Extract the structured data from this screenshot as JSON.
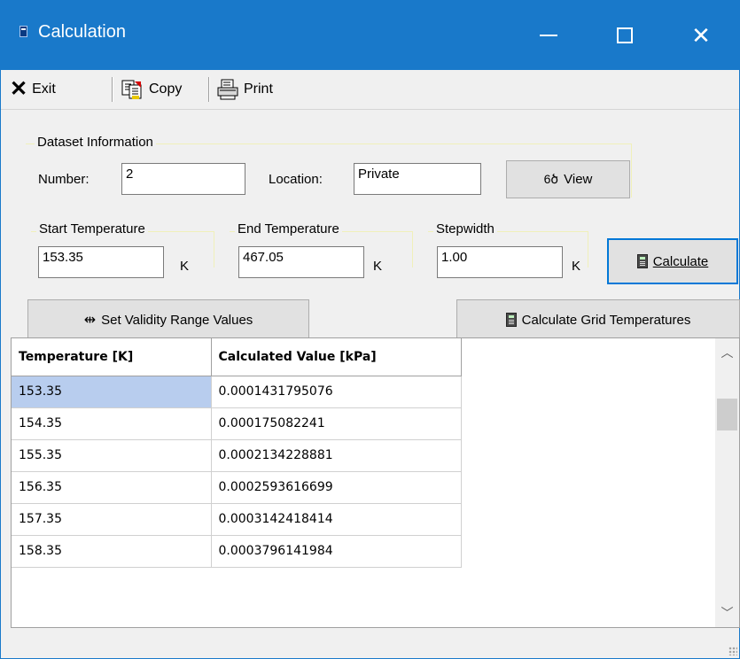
{
  "window": {
    "title": "Calculation"
  },
  "toolbar": {
    "exit_label": "Exit",
    "copy_label": "Copy",
    "print_label": "Print"
  },
  "dataset": {
    "group_label": "Dataset Information",
    "number_label": "Number:",
    "number_value": "2",
    "location_label": "Location:",
    "location_value": "Private",
    "view_label": "View"
  },
  "range": {
    "start_label": "Start Temperature",
    "start_value": "153.35",
    "end_label": "End Temperature",
    "end_value": "467.05",
    "step_label": "Stepwidth",
    "step_value": "1.00",
    "unit": "K",
    "calculate_label": "Calculate"
  },
  "actions": {
    "validity_label": "Set Validity Range Values",
    "grid_calc_label": "Calculate Grid Temperatures"
  },
  "table": {
    "columns": [
      "Temperature [K]",
      "Calculated Value [kPa]"
    ],
    "rows": [
      [
        "153.35",
        "0.0001431795076"
      ],
      [
        "154.35",
        "0.000175082241"
      ],
      [
        "155.35",
        "0.0002134228881"
      ],
      [
        "156.35",
        "0.0002593616699"
      ],
      [
        "157.35",
        "0.0003142418414"
      ],
      [
        "158.35",
        "0.0003796141984"
      ]
    ]
  },
  "colors": {
    "titlebar": "#1979ca",
    "selection": "#b8cdee",
    "default_button_border": "#0078d7"
  },
  "icons": [
    "app-icon",
    "minimize-icon",
    "maximize-icon",
    "close-icon",
    "exit-x-icon",
    "copy-icon",
    "print-icon",
    "glasses-icon",
    "calculator-icon",
    "range-arrows-icon",
    "scroll-up-icon",
    "scroll-down-icon",
    "resize-grip-icon"
  ]
}
